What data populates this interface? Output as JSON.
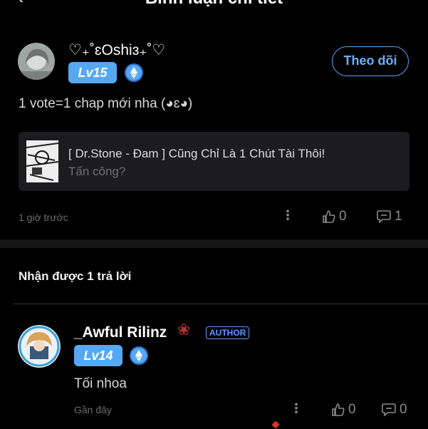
{
  "header": {
    "title": "Bình luận chi tiết",
    "back_icon": "chevron-left-icon"
  },
  "comment": {
    "username": "♡₊˚ɛOshiɜ₊˚♡",
    "level": "Lv15",
    "follow_label": "Theo dõi",
    "text": "1 vote=1 chap mới nha (◕ɛ◕)",
    "quote": {
      "title": "[ Dr.Stone - Đam ] Cũng Chỉ Là 1 Chút Tài Thôi!",
      "subtitle": "Tấn công?"
    },
    "time": "1 giờ trước",
    "likes": "0",
    "replies": "1"
  },
  "replies_header": "Nhận được 1 trả lời",
  "reply": {
    "username": "_Awful Rilinz",
    "author_tag": "AUTHOR",
    "level": "Lv14",
    "text": "Tối nhoa",
    "time": "Gần đây",
    "likes": "0",
    "replies": "0"
  },
  "colors": {
    "accent": "#56a8f3",
    "link": "#6cb0ff",
    "background": "#000000",
    "card": "#1c1c1e"
  }
}
